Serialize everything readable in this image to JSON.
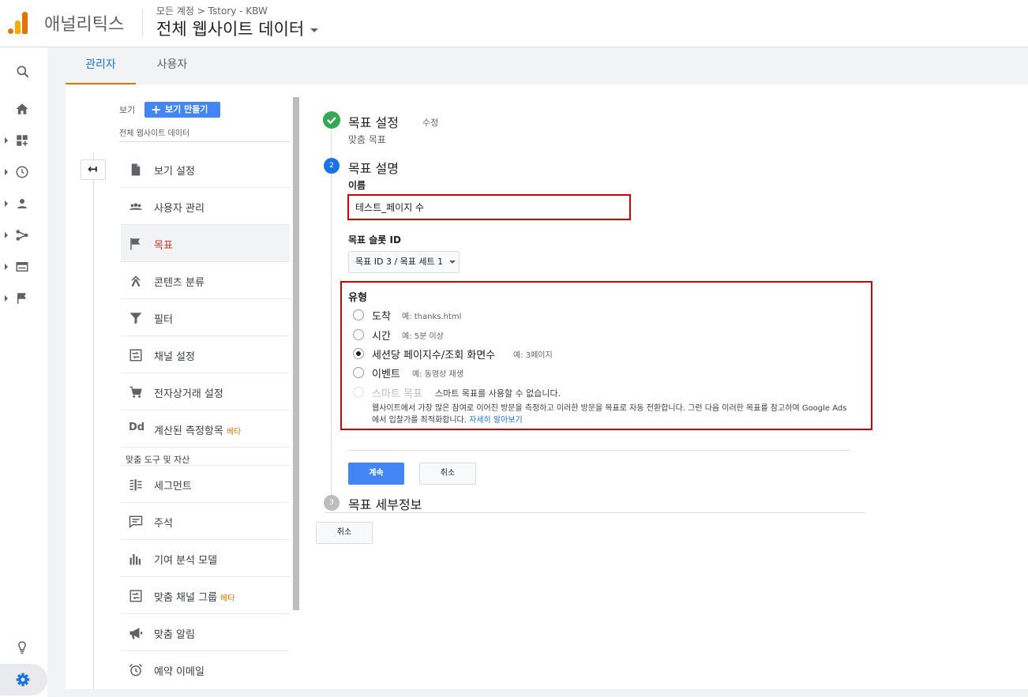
{
  "header": {
    "brand": "애널리틱스",
    "breadcrumb": "모든 계정 > Tstory - KBW",
    "account_title": "전체 웹사이트 데이터"
  },
  "tabs": [
    {
      "label": "관리자",
      "active": true
    },
    {
      "label": "사용자",
      "active": false
    }
  ],
  "view": {
    "label": "보기",
    "create_button": "보기 만들기",
    "name": "전체 웹사이트 데이터"
  },
  "menu": {
    "items": [
      {
        "label": "보기 설정",
        "icon": "file-icon"
      },
      {
        "label": "사용자 관리",
        "icon": "users-icon"
      },
      {
        "label": "목표",
        "icon": "flag-icon",
        "active": true
      },
      {
        "label": "콘텐츠 분류",
        "icon": "content-grouping-icon"
      },
      {
        "label": "필터",
        "icon": "filter-icon"
      },
      {
        "label": "채널 설정",
        "icon": "channel-settings-icon"
      },
      {
        "label": "전자상거래 설정",
        "icon": "cart-icon"
      },
      {
        "label": "계산된 측정항목",
        "icon": "dd-icon",
        "badge": "베타"
      }
    ],
    "section_label": "맞춤 도구 및 자산",
    "tools": [
      {
        "label": "세그먼트",
        "icon": "segments-icon"
      },
      {
        "label": "주석",
        "icon": "annotation-icon"
      },
      {
        "label": "기여 분석 모델",
        "icon": "attribution-icon"
      },
      {
        "label": "맞춤 채널 그룹",
        "icon": "channel-group-icon",
        "badge": "베타"
      },
      {
        "label": "맞춤 알림",
        "icon": "megaphone-icon"
      },
      {
        "label": "예약 이메일",
        "icon": "alarm-icon"
      }
    ]
  },
  "form": {
    "step1": {
      "title": "목표 설정",
      "edit": "수정",
      "subtitle": "맞춤 목표"
    },
    "step2": {
      "number": "2",
      "title": "목표 설명"
    },
    "name_label": "이름",
    "name_value": "테스트_페이지 수",
    "slot_label": "목표 슬롯 ID",
    "slot_value": "목표 ID 3 / 목표 세트 1",
    "type_label": "유형",
    "types": [
      {
        "label": "도착",
        "example": "예: thanks.html",
        "checked": false
      },
      {
        "label": "시간",
        "example": "예: 5분 이상",
        "checked": false
      },
      {
        "label": "세션당 페이지수/조회 화면수",
        "example": "예: 3페이지",
        "checked": true
      },
      {
        "label": "이벤트",
        "example": "예: 동영상 재생",
        "checked": false
      },
      {
        "label": "스마트 목표",
        "example": "스마트 목표를 사용할 수 없습니다.",
        "checked": false,
        "disabled": true
      }
    ],
    "smart_note": "웹사이트에서 가장 많은 참여로 이어진 방문을 측정하고 이러한 방문을 목표로 자동 전환합니다. 그런 다음 이러한 목표를 참고하여 Google Ads에서 입찰가를 최적화합니다.",
    "smart_link": "자세히 알아보기",
    "continue_button": "계속",
    "cancel_button": "취소",
    "step3": {
      "number": "3",
      "title": "목표 세부정보"
    },
    "bottom_cancel": "취소"
  }
}
